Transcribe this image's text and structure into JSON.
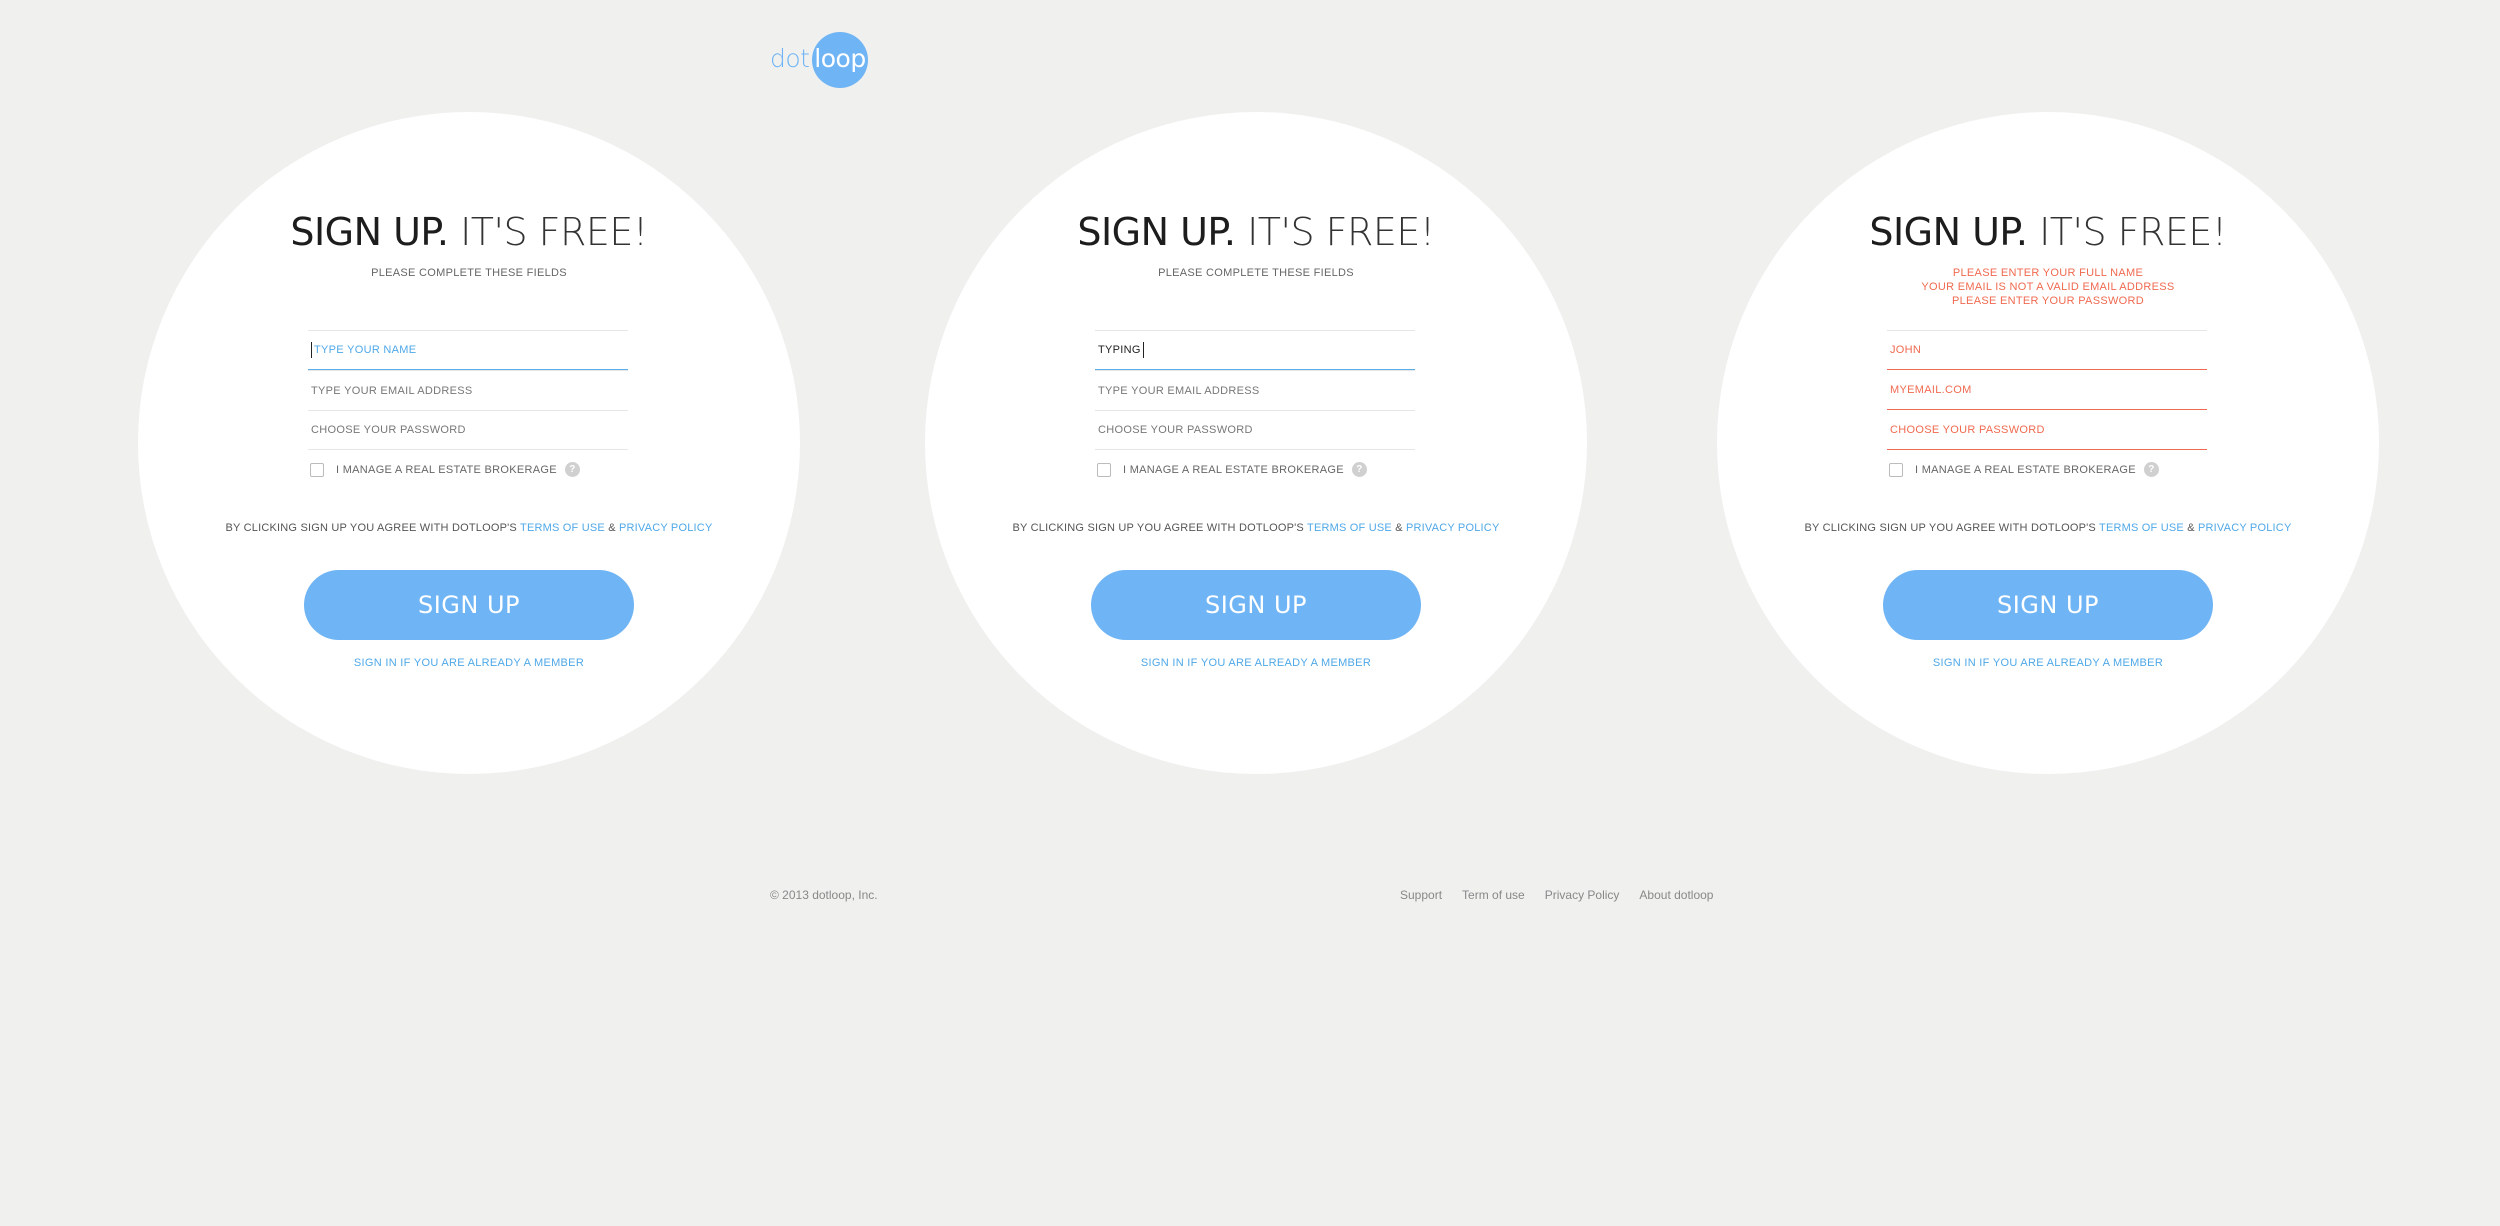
{
  "logo": {
    "left": "dot",
    "right": "loop"
  },
  "panels": [
    {
      "title_bold": "SIGN UP.",
      "title_light": " IT'S FREE!",
      "subtitle": "PLEASE COMPLETE THESE FIELDS",
      "name_field": "TYPE YOUR NAME",
      "email_field": "TYPE YOUR EMAIL ADDRESS",
      "password_field": "CHOOSE YOUR PASSWORD",
      "checkbox_label": "I MANAGE A REAL ESTATE BROKERAGE",
      "help": "?",
      "agree_text": "BY CLICKING SIGN UP YOU AGREE WITH DOTLOOP'S ",
      "terms": "TERMS OF USE",
      "amp": " & ",
      "privacy": "PRIVACY POLICY",
      "button": "SIGN UP",
      "signin": "SIGN IN IF YOU ARE ALREADY A MEMBER"
    },
    {
      "title_bold": "SIGN UP.",
      "title_light": " IT'S FREE!",
      "subtitle": "PLEASE COMPLETE THESE FIELDS",
      "name_field": "TYPING",
      "email_field": "TYPE YOUR EMAIL ADDRESS",
      "password_field": "CHOOSE YOUR PASSWORD",
      "checkbox_label": "I MANAGE A REAL ESTATE BROKERAGE",
      "help": "?",
      "agree_text": "BY CLICKING SIGN UP YOU AGREE WITH DOTLOOP'S ",
      "terms": "TERMS OF USE",
      "amp": " & ",
      "privacy": "PRIVACY POLICY",
      "button": "SIGN UP",
      "signin": "SIGN IN IF YOU ARE ALREADY A MEMBER"
    },
    {
      "title_bold": "SIGN UP.",
      "title_light": " IT'S FREE!",
      "errors": [
        "PLEASE ENTER YOUR FULL NAME",
        "YOUR EMAIL IS NOT A VALID EMAIL ADDRESS",
        "PLEASE ENTER YOUR PASSWORD"
      ],
      "name_field": "JOHN",
      "email_field": "MYEMAIL.COM",
      "password_field": "CHOOSE YOUR PASSWORD",
      "checkbox_label": "I MANAGE A REAL ESTATE BROKERAGE",
      "help": "?",
      "agree_text": "BY CLICKING SIGN UP YOU AGREE WITH DOTLOOP'S ",
      "terms": "TERMS OF USE",
      "amp": " & ",
      "privacy": "PRIVACY POLICY",
      "button": "SIGN UP",
      "signin": "SIGN IN IF YOU ARE ALREADY A MEMBER"
    }
  ],
  "footer": {
    "copyright": "© 2013 dotloop, Inc.",
    "links": [
      "Support",
      "Term of use",
      "Privacy Policy",
      "About dotloop"
    ]
  },
  "colors": {
    "accent": "#6fb4f4",
    "link": "#4fa8e8",
    "error": "#f06a50",
    "background": "#f0f0ef"
  }
}
